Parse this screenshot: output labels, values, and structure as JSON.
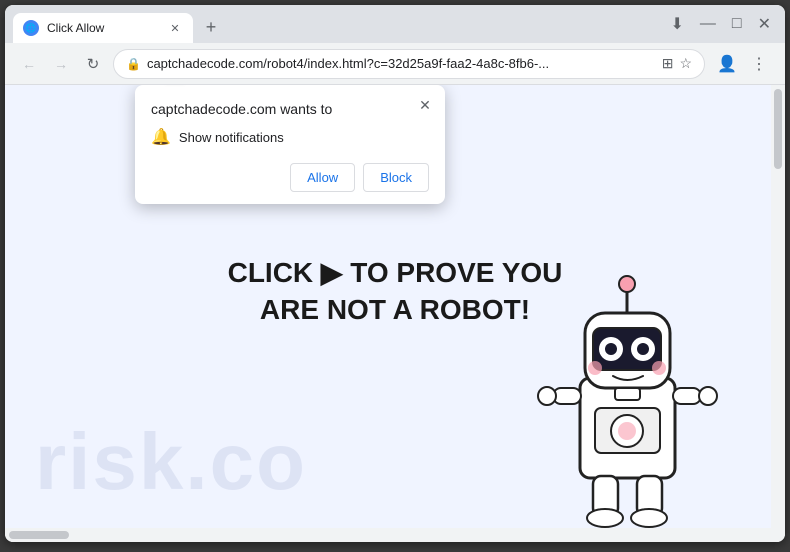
{
  "browser": {
    "tab": {
      "title": "Click Allow",
      "favicon": "🌐"
    },
    "controls": {
      "minimize": "—",
      "maximize": "□",
      "close": "✕",
      "new_tab": "+"
    },
    "address_bar": {
      "url": "captchadecode.com/robot4/index.html?c=32d25a9f-faa2-4a8c-8fb6-...",
      "lock_icon": "🔒",
      "back_icon": "←",
      "forward_icon": "→",
      "reload_icon": "↻"
    },
    "download_icon": "⬇",
    "star_icon": "☆",
    "account_icon": "👤",
    "menu_icon": "⋮"
  },
  "popup": {
    "title": "captchadecode.com wants to",
    "close_icon": "✕",
    "permission": {
      "icon": "🔔",
      "text": "Show notifications"
    },
    "buttons": {
      "allow": "Allow",
      "block": "Block"
    }
  },
  "page": {
    "heading_line1": "CLICK",
    "heading_line2_partial": "TO PROVE YOU",
    "heading_line3": "ARE NOT A ROBOT!",
    "watermark": "risk.co"
  }
}
